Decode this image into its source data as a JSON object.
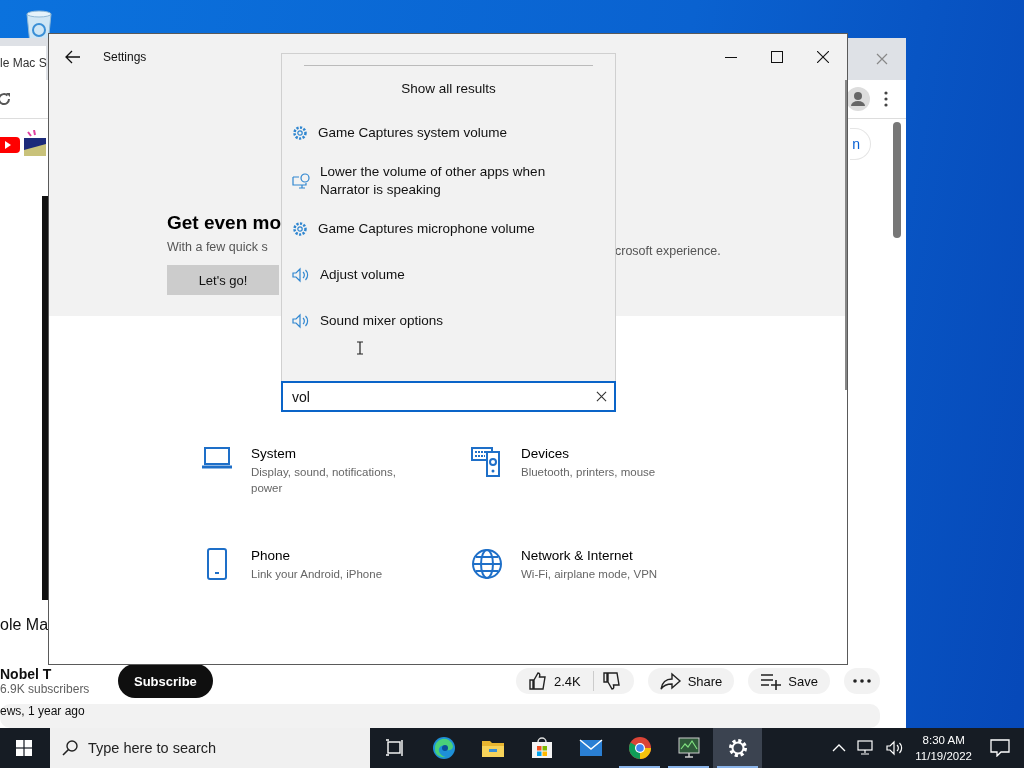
{
  "browser_window": {
    "tab_title": "le Mac S",
    "sign_in_fragment": "n",
    "video_title": "ole Ma",
    "channel": "Nobel T",
    "subscribers": "6.9K subscribers",
    "subscribe_button": "Subscribe",
    "likes": "2.4K",
    "actions": [
      {
        "kind": "share",
        "label": "Share"
      },
      {
        "kind": "save",
        "label": "Save"
      }
    ],
    "meta": "ews, 1 year ago"
  },
  "settings_window": {
    "title": "Settings",
    "banner": {
      "heading": "Get even mo",
      "text_left": "With a few quick s",
      "text_right": "crosoft experience.",
      "button": "Let's go!"
    },
    "search": {
      "value": "vol",
      "results_header": "Show all results",
      "results": [
        {
          "kind": "gear",
          "label": "Game Captures system volume"
        },
        {
          "kind": "narrator",
          "label": "Lower the volume of other apps when Narrator is speaking"
        },
        {
          "kind": "gear",
          "label": "Game Captures microphone volume"
        },
        {
          "kind": "speaker",
          "label": "Adjust volume"
        },
        {
          "kind": "speaker",
          "label": "Sound mixer options"
        }
      ]
    },
    "categories": [
      {
        "kind": "laptop",
        "title": "System",
        "subtitle": "Display, sound, notifications, power"
      },
      {
        "kind": "devices",
        "title": "Devices",
        "subtitle": "Bluetooth, printers, mouse"
      },
      {
        "kind": "phone",
        "title": "Phone",
        "subtitle": "Link your Android, iPhone"
      },
      {
        "kind": "globe",
        "title": "Network & Internet",
        "subtitle": "Wi-Fi, airplane mode, VPN"
      }
    ]
  },
  "taskbar": {
    "search_placeholder": "Type here to search",
    "apps": [
      {
        "kind": "taskview",
        "running": false,
        "selected": false
      },
      {
        "kind": "edge",
        "running": false,
        "selected": false
      },
      {
        "kind": "explorer",
        "running": false,
        "selected": false
      },
      {
        "kind": "store",
        "running": false,
        "selected": false
      },
      {
        "kind": "mail",
        "running": false,
        "selected": false
      },
      {
        "kind": "chrome",
        "running": true,
        "selected": false
      },
      {
        "kind": "monitor",
        "running": true,
        "selected": false
      },
      {
        "kind": "settings",
        "running": true,
        "selected": true
      }
    ],
    "time": "8:30 AM",
    "date": "11/19/2022"
  }
}
